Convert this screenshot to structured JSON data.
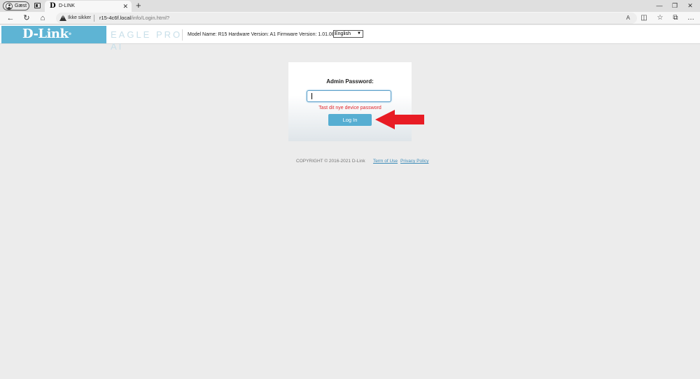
{
  "browser": {
    "profile_label": "Gæst",
    "tab_favicon": "D",
    "tab_title": "D-LINK",
    "tab_close": "✕",
    "new_tab": "+",
    "window_minimize": "—",
    "window_restore": "❐",
    "window_close": "✕",
    "back": "←",
    "reload": "↻",
    "home": "⌂",
    "security_label": "Ikke sikker",
    "url_host": "r15-4c6f.local",
    "url_path": "/info/Login.html?",
    "read_aloud": "A",
    "split_screen": "◫",
    "favorites": "☆",
    "collections": "⧉",
    "more": "…"
  },
  "header": {
    "logo": "D-Link",
    "logo_reg": "®",
    "product": "EAGLE PRO AI",
    "device_info": "Model Name: R15 Hardware Version: A1 Firmware Version: 1.01.08",
    "language_selected": "English"
  },
  "login": {
    "label": "Admin Password:",
    "password_value": "",
    "hint": "Tast dit nye device password",
    "button": "Log In"
  },
  "footer": {
    "copyright": "COPYRIGHT © 2016-2021 D-Link",
    "terms": "Term of Use",
    "privacy": "Privacy Policy"
  },
  "annotation": {
    "arrow_color": "#e81c24"
  },
  "colors": {
    "brand_blue": "#5eb4d4",
    "button_blue": "#56aed2",
    "hint_red": "#e0262b",
    "link_blue": "#3c8bb8"
  }
}
